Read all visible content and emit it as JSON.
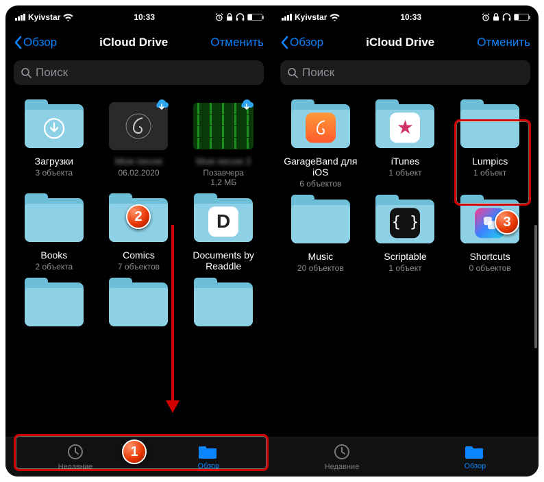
{
  "status": {
    "carrier": "Kyivstar",
    "time": "10:33",
    "wifi": "wifi-icon",
    "icons": [
      "alarm",
      "lock",
      "headphones",
      "battery"
    ]
  },
  "nav": {
    "back": "Обзор",
    "title": "iCloud Drive",
    "cancel": "Отменить"
  },
  "search": {
    "placeholder": "Поиск"
  },
  "tabs": {
    "recent": "Недавние",
    "browse": "Обзор"
  },
  "left": {
    "items": [
      {
        "name": "Загрузки",
        "sub": "3 объекта",
        "kind": "folder-download"
      },
      {
        "name": "Моя песня",
        "sub": "06.02.2020",
        "kind": "gb-thumb",
        "blurred": true
      },
      {
        "name": "Моя песня 2",
        "sub": "Позавчера\n1,2 МБ",
        "kind": "green",
        "blurred": true
      },
      {
        "name": "Books",
        "sub": "2 объекта",
        "kind": "folder"
      },
      {
        "name": "Comics",
        "sub": "7 объектов",
        "kind": "folder"
      },
      {
        "name": "Documents by Readdle",
        "sub": "",
        "kind": "readdle"
      }
    ]
  },
  "right": {
    "items": [
      {
        "name": "GarageBand для iOS",
        "sub": "6 объектов",
        "kind": "gb-app"
      },
      {
        "name": "iTunes",
        "sub": "1 объект",
        "kind": "itunes"
      },
      {
        "name": "Lumpics",
        "sub": "1 объект",
        "kind": "folder"
      },
      {
        "name": "Music",
        "sub": "20 объектов",
        "kind": "folder"
      },
      {
        "name": "Scriptable",
        "sub": "1 объект",
        "kind": "scriptable"
      },
      {
        "name": "Shortcuts",
        "sub": "0 объектов",
        "kind": "shortcuts"
      }
    ]
  },
  "annot": {
    "b1": "1",
    "b2": "2",
    "b3": "3"
  }
}
